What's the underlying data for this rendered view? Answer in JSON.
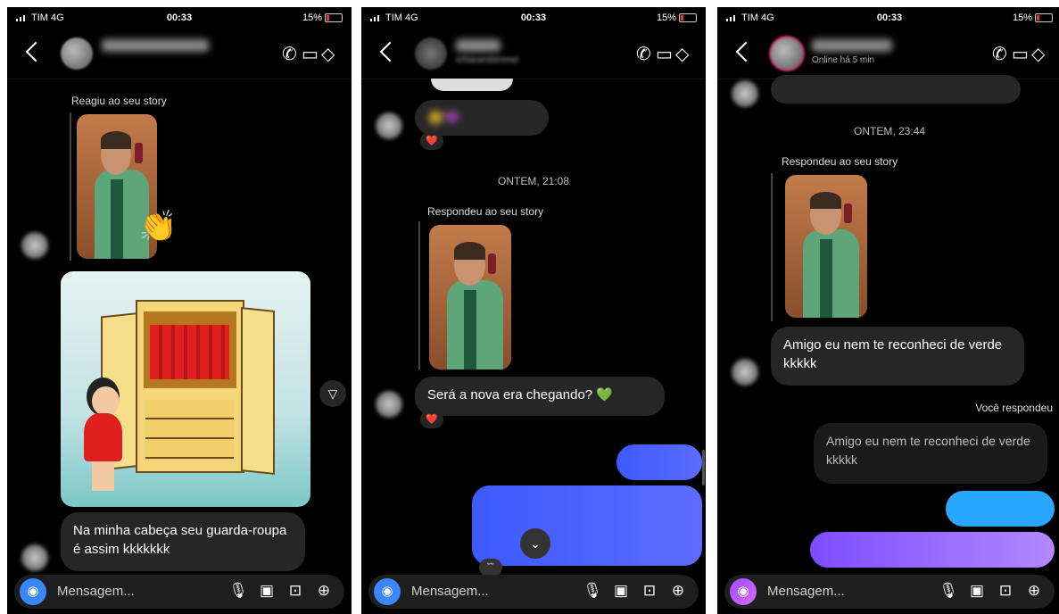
{
  "status": {
    "carrier": "TIM 4G",
    "time": "00:33",
    "battery": "15%"
  },
  "composer": {
    "placeholder": "Mensagem..."
  },
  "icons": {
    "call": "phone-icon",
    "video": "video-icon",
    "tag": "tag-icon",
    "camera": "camera-icon",
    "mic": "mic-icon",
    "gallery": "gallery-icon",
    "sticker": "sticker-icon",
    "plus": "plus-icon"
  },
  "panel1": {
    "context": "Reagiu ao seu story",
    "reaction": "👏",
    "message": "Na minha cabeça seu guarda-roupa é assim kkkkkkk"
  },
  "panel2": {
    "handle": "ichlarambimmel",
    "heart": "❤️",
    "blurred_emojis": "😊💜",
    "date": "ONTEM, 21:08",
    "context": "Respondeu ao seu story",
    "message": "Será a nova era chegando? 💚"
  },
  "panel3": {
    "status": "Online há 5 min",
    "date": "ONTEM, 23:44",
    "context": "Respondeu ao seu story",
    "message": "Amigo eu nem te reconheci de verde kkkkk",
    "you_replied": "Você respondeu",
    "quoted": "Amigo eu nem te reconheci de verde kkkkk"
  }
}
